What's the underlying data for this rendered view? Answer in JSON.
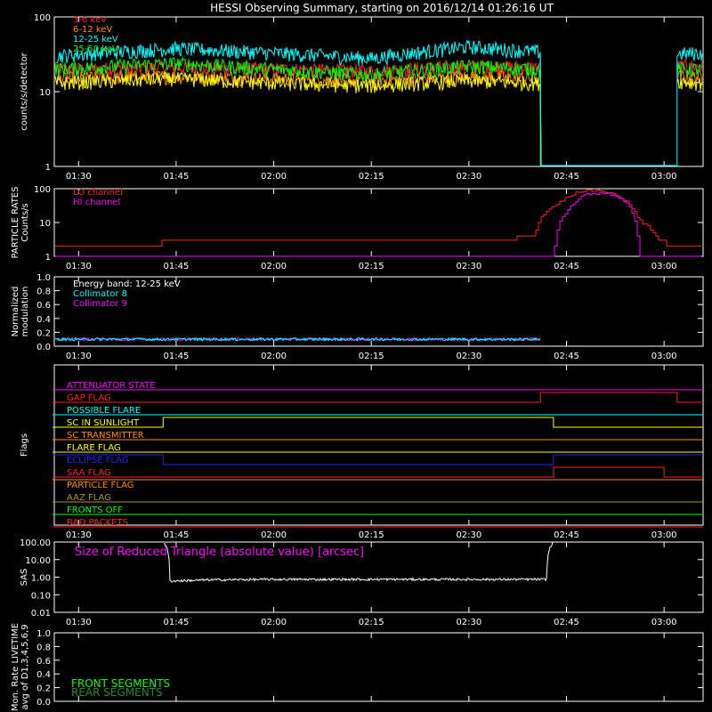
{
  "title": "HESSI Observing Summary, starting on 2016/12/14 01:26:16 UT",
  "colors": {
    "background": "#000000",
    "axes": "#ffffff",
    "red": "#ff2020",
    "orange": "#ff8c00",
    "yellow": "#ffff00",
    "green": "#00ff00",
    "cyan": "#00ffff",
    "magenta": "#ff00ff",
    "blue": "#2020ff",
    "olive": "#a09a30",
    "darkgreen": "#228b22",
    "white": "#ffffff"
  },
  "time_ticks": [
    "01:30",
    "01:45",
    "02:00",
    "02:15",
    "02:30",
    "02:45",
    "03:00"
  ],
  "chart_data": [
    {
      "id": "count_rates",
      "type": "line",
      "ylabel": "counts/s/detector",
      "yscale": "log",
      "ylim": [
        1,
        100
      ],
      "ytick_labels": [
        "100",
        "10",
        "1"
      ],
      "x_range": [
        "01:26:16",
        "03:06:00"
      ],
      "gap": [
        "02:41:00",
        "03:02:00"
      ],
      "series": [
        {
          "name": "3-6 keV",
          "color": "#ff2020",
          "x": [
            "01:26",
            "01:45",
            "02:00",
            "02:15",
            "02:30",
            "02:41",
            "03:02",
            "03:06"
          ],
          "y": [
            20,
            21,
            20,
            19,
            22,
            21,
            22,
            22
          ]
        },
        {
          "name": "6-12 keV",
          "color": "#ff8c00",
          "x": [
            "01:26",
            "01:45",
            "02:00",
            "02:15",
            "02:30",
            "02:41",
            "03:02",
            "03:06"
          ],
          "y": [
            15,
            16,
            15,
            14,
            16,
            15,
            16,
            16
          ]
        },
        {
          "name": "12-25 keV",
          "color": "#00ffff",
          "x": [
            "01:26",
            "01:45",
            "02:00",
            "02:15",
            "02:30",
            "02:41",
            "03:02",
            "03:06"
          ],
          "y": [
            30,
            38,
            33,
            28,
            40,
            34,
            32,
            33
          ]
        },
        {
          "name": "25-50 keV",
          "color": "#00ff00",
          "x": [
            "01:26",
            "01:45",
            "02:00",
            "02:15",
            "02:30",
            "02:41",
            "03:02",
            "03:06"
          ],
          "y": [
            20,
            24,
            20,
            17,
            22,
            20,
            20,
            20
          ]
        },
        {
          "name": "",
          "color": "#ffff00",
          "x": [
            "01:26",
            "01:45",
            "02:00",
            "02:15",
            "02:30",
            "02:41",
            "03:02",
            "03:06"
          ],
          "y": [
            13,
            15,
            13,
            12,
            14,
            13,
            14,
            13
          ]
        }
      ]
    },
    {
      "id": "particle_rates",
      "type": "line",
      "ylabel": "PARTICLE RATES Counts/s",
      "yscale": "log",
      "ylim": [
        1,
        100
      ],
      "ytick_labels": [
        "100",
        "10",
        "1"
      ],
      "series": [
        {
          "name": "LO channel",
          "color": "#ff2020",
          "x": [
            "01:26",
            "01:40",
            "01:45",
            "02:00",
            "02:15",
            "02:25",
            "02:35",
            "02:40",
            "02:44",
            "02:47",
            "02:50",
            "02:53",
            "02:56",
            "02:59",
            "03:01",
            "03:06"
          ],
          "y": [
            2,
            2,
            3,
            3,
            3,
            3,
            3,
            4,
            40,
            85,
            90,
            60,
            12,
            3,
            2,
            2
          ]
        },
        {
          "name": "HI channel",
          "color": "#ff00ff",
          "x": [
            "01:26",
            "02:43",
            "02:45",
            "02:48",
            "02:51",
            "02:54",
            "02:56",
            "03:06"
          ],
          "y": [
            1,
            1,
            20,
            70,
            75,
            40,
            1,
            1
          ]
        }
      ]
    },
    {
      "id": "modulation",
      "type": "line",
      "ylabel": "Normalized modulation",
      "ylim": [
        0,
        1
      ],
      "ytick_labels": [
        "1.0",
        "0.8",
        "0.6",
        "0.4",
        "0.2",
        "0.0"
      ],
      "annotation": "Energy band: 12-25 keV",
      "series": [
        {
          "name": "Collimator 8",
          "color": "#00ffff",
          "x": [
            "01:26",
            "02:41",
            "03:01",
            "03:06"
          ],
          "y": [
            0.1,
            0.1,
            null,
            0.1
          ]
        },
        {
          "name": "Collimator 9",
          "color": "#ff00ff",
          "x": [
            "01:26",
            "02:41",
            "03:01",
            "03:06"
          ],
          "y": [
            0.1,
            0.1,
            null,
            0.1
          ]
        }
      ]
    },
    {
      "id": "flags",
      "type": "line",
      "ylabel": "Flags",
      "series": [
        {
          "name": "ATTENUATOR STATE",
          "color": "#ff00ff",
          "x": [
            "01:26",
            "03:06"
          ],
          "y": [
            0,
            0
          ]
        },
        {
          "name": "GAP FLAG",
          "color": "#ff2020",
          "x": [
            "01:26",
            "02:41",
            "02:41",
            "03:02",
            "03:02",
            "03:06"
          ],
          "y": [
            0,
            0,
            1,
            1,
            0,
            0
          ]
        },
        {
          "name": "POSSIBLE FLARE",
          "color": "#00ffff",
          "x": [
            "01:26",
            "03:06"
          ],
          "y": [
            0,
            0
          ]
        },
        {
          "name": "SC IN SUNLIGHT",
          "color": "#ffff00",
          "x": [
            "01:26",
            "01:43",
            "01:43",
            "02:43",
            "02:43",
            "03:06"
          ],
          "y": [
            0,
            0,
            1,
            1,
            0,
            0
          ]
        },
        {
          "name": "SC TRANSMITTER",
          "color": "#ff8c00",
          "x": [
            "01:26",
            "03:06"
          ],
          "y": [
            0,
            0
          ]
        },
        {
          "name": "FLARE FLAG",
          "color": "#ffff00",
          "x": [
            "01:26",
            "03:06"
          ],
          "y": [
            0,
            0
          ]
        },
        {
          "name": "ECLIPSE FLAG",
          "color": "#2020ff",
          "x": [
            "01:26",
            "01:43",
            "01:43",
            "02:43",
            "02:43",
            "03:06"
          ],
          "y": [
            1,
            1,
            0,
            0,
            1,
            1
          ]
        },
        {
          "name": "SAA FLAG",
          "color": "#ff2020",
          "x": [
            "01:26",
            "02:43",
            "02:43",
            "03:00",
            "03:00",
            "03:06"
          ],
          "y": [
            0,
            0,
            1,
            1,
            0,
            0
          ]
        },
        {
          "name": "PARTICLE FLAG",
          "color": "#ff8c00",
          "x": [
            "01:26",
            "03:06"
          ],
          "y": [
            1,
            1
          ]
        },
        {
          "name": "AAZ FLAG",
          "color": "#a09a30",
          "x": [
            "01:26",
            "03:06"
          ],
          "y": [
            0,
            0
          ]
        },
        {
          "name": "FRONTS OFF",
          "color": "#00ff00",
          "x": [
            "01:26",
            "03:06"
          ],
          "y": [
            0,
            0
          ]
        },
        {
          "name": "BAD PACKETS",
          "color": "#ff2020",
          "x": [
            "01:26",
            "03:06"
          ],
          "y": [
            0,
            0
          ]
        }
      ]
    },
    {
      "id": "sas",
      "type": "line",
      "ylabel": "SAS",
      "yscale": "log",
      "ylim": [
        0.01,
        100
      ],
      "ytick_labels": [
        "100.00",
        "10.00",
        "1.00",
        "0.10",
        "0.01"
      ],
      "annotation": "Size of Reduced Triangle (absolute value) [arcsec]",
      "series": [
        {
          "name": "",
          "color": "#ffffff",
          "x": [
            "01:43",
            "01:44",
            "01:50",
            "02:00",
            "02:15",
            "02:30",
            "02:42",
            "02:43"
          ],
          "y": [
            100,
            0.6,
            0.7,
            0.75,
            0.75,
            0.75,
            0.75,
            100
          ]
        }
      ]
    },
    {
      "id": "livetime",
      "type": "line",
      "ylabel": "Mon. Rate LIVETIME avg of D1,3,4,5,6,9",
      "ylim": [
        0,
        1
      ],
      "ytick_labels": [
        "1.0",
        "0.8",
        "0.6",
        "0.4",
        "0.2",
        "0.0"
      ],
      "series": [
        {
          "name": "FRONT SEGMENTS",
          "color": "#00ff00",
          "x": [],
          "y": []
        },
        {
          "name": "REAR SEGMENTS",
          "color": "#228b22",
          "x": [],
          "y": []
        }
      ]
    }
  ]
}
